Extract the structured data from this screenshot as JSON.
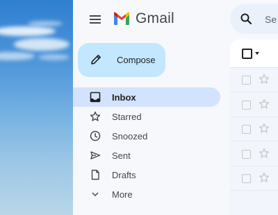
{
  "header": {
    "app_name": "Gmail",
    "search_placeholder": "Se"
  },
  "compose": {
    "label": "Compose"
  },
  "nav": [
    {
      "label": "Inbox",
      "icon": "inbox-icon",
      "active": true
    },
    {
      "label": "Starred",
      "icon": "star-icon",
      "active": false
    },
    {
      "label": "Snoozed",
      "icon": "clock-icon",
      "active": false
    },
    {
      "label": "Sent",
      "icon": "send-icon",
      "active": false
    },
    {
      "label": "Drafts",
      "icon": "draft-icon",
      "active": false
    },
    {
      "label": "More",
      "icon": "chevron-down-icon",
      "active": false
    }
  ],
  "colors": {
    "compose_bg": "#c2e7ff",
    "active_nav_bg": "#d3e3fd",
    "app_bg": "#f6f8fc"
  },
  "message_rows": 5
}
